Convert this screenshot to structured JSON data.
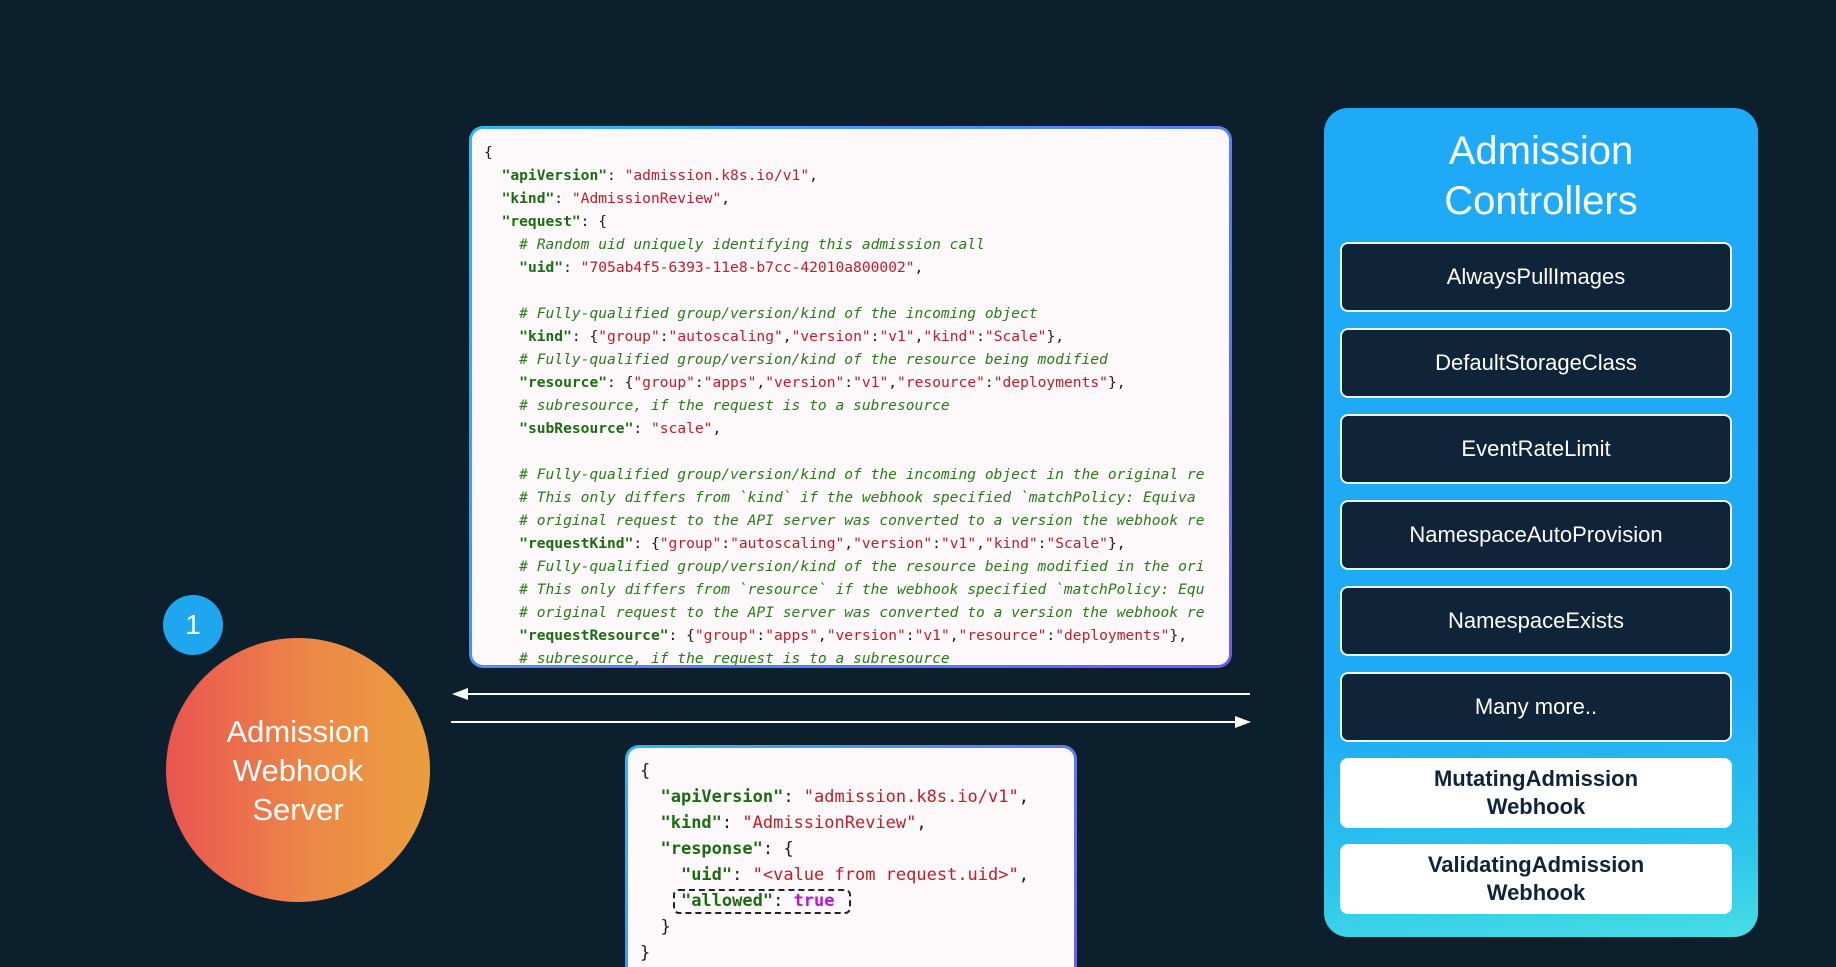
{
  "request_code": {
    "lines": [
      [
        [
          "p",
          "{"
        ]
      ],
      [
        [
          "p",
          "  "
        ],
        [
          "k",
          "\"apiVersion\""
        ],
        [
          "p",
          ": "
        ],
        [
          "s",
          "\"admission.k8s.io/v1\""
        ],
        [
          "p",
          ","
        ]
      ],
      [
        [
          "p",
          "  "
        ],
        [
          "k",
          "\"kind\""
        ],
        [
          "p",
          ": "
        ],
        [
          "s",
          "\"AdmissionReview\""
        ],
        [
          "p",
          ","
        ]
      ],
      [
        [
          "p",
          "  "
        ],
        [
          "k",
          "\"request\""
        ],
        [
          "p",
          ": {"
        ]
      ],
      [
        [
          "p",
          "    "
        ],
        [
          "c",
          "# Random uid uniquely identifying this admission call"
        ]
      ],
      [
        [
          "p",
          "    "
        ],
        [
          "k",
          "\"uid\""
        ],
        [
          "p",
          ": "
        ],
        [
          "s",
          "\"705ab4f5-6393-11e8-b7cc-42010a800002\""
        ],
        [
          "p",
          ","
        ]
      ],
      [
        [
          "p",
          ""
        ]
      ],
      [
        [
          "p",
          "    "
        ],
        [
          "c",
          "# Fully-qualified group/version/kind of the incoming object"
        ]
      ],
      [
        [
          "p",
          "    "
        ],
        [
          "k",
          "\"kind\""
        ],
        [
          "p",
          ": {"
        ],
        [
          "s",
          "\"group\""
        ],
        [
          "p",
          ":"
        ],
        [
          "s",
          "\"autoscaling\""
        ],
        [
          "p",
          ","
        ],
        [
          "s",
          "\"version\""
        ],
        [
          "p",
          ":"
        ],
        [
          "s",
          "\"v1\""
        ],
        [
          "p",
          ","
        ],
        [
          "s",
          "\"kind\""
        ],
        [
          "p",
          ":"
        ],
        [
          "s",
          "\"Scale\""
        ],
        [
          "p",
          "},"
        ]
      ],
      [
        [
          "p",
          "    "
        ],
        [
          "c",
          "# Fully-qualified group/version/kind of the resource being modified"
        ]
      ],
      [
        [
          "p",
          "    "
        ],
        [
          "k",
          "\"resource\""
        ],
        [
          "p",
          ": {"
        ],
        [
          "s",
          "\"group\""
        ],
        [
          "p",
          ":"
        ],
        [
          "s",
          "\"apps\""
        ],
        [
          "p",
          ","
        ],
        [
          "s",
          "\"version\""
        ],
        [
          "p",
          ":"
        ],
        [
          "s",
          "\"v1\""
        ],
        [
          "p",
          ","
        ],
        [
          "s",
          "\"resource\""
        ],
        [
          "p",
          ":"
        ],
        [
          "s",
          "\"deployments\""
        ],
        [
          "p",
          "},"
        ]
      ],
      [
        [
          "p",
          "    "
        ],
        [
          "c",
          "# subresource, if the request is to a subresource"
        ]
      ],
      [
        [
          "p",
          "    "
        ],
        [
          "k",
          "\"subResource\""
        ],
        [
          "p",
          ": "
        ],
        [
          "s",
          "\"scale\""
        ],
        [
          "p",
          ","
        ]
      ],
      [
        [
          "p",
          ""
        ]
      ],
      [
        [
          "p",
          "    "
        ],
        [
          "c",
          "# Fully-qualified group/version/kind of the incoming object in the original re"
        ]
      ],
      [
        [
          "p",
          "    "
        ],
        [
          "c",
          "# This only differs from `kind` if the webhook specified `matchPolicy: Equiva"
        ]
      ],
      [
        [
          "p",
          "    "
        ],
        [
          "c",
          "# original request to the API server was converted to a version the webhook re"
        ]
      ],
      [
        [
          "p",
          "    "
        ],
        [
          "k",
          "\"requestKind\""
        ],
        [
          "p",
          ": {"
        ],
        [
          "s",
          "\"group\""
        ],
        [
          "p",
          ":"
        ],
        [
          "s",
          "\"autoscaling\""
        ],
        [
          "p",
          ","
        ],
        [
          "s",
          "\"version\""
        ],
        [
          "p",
          ":"
        ],
        [
          "s",
          "\"v1\""
        ],
        [
          "p",
          ","
        ],
        [
          "s",
          "\"kind\""
        ],
        [
          "p",
          ":"
        ],
        [
          "s",
          "\"Scale\""
        ],
        [
          "p",
          "},"
        ]
      ],
      [
        [
          "p",
          "    "
        ],
        [
          "c",
          "# Fully-qualified group/version/kind of the resource being modified in the ori"
        ]
      ],
      [
        [
          "p",
          "    "
        ],
        [
          "c",
          "# This only differs from `resource` if the webhook specified `matchPolicy: Equ"
        ]
      ],
      [
        [
          "p",
          "    "
        ],
        [
          "c",
          "# original request to the API server was converted to a version the webhook re"
        ]
      ],
      [
        [
          "p",
          "    "
        ],
        [
          "k",
          "\"requestResource\""
        ],
        [
          "p",
          ": {"
        ],
        [
          "s",
          "\"group\""
        ],
        [
          "p",
          ":"
        ],
        [
          "s",
          "\"apps\""
        ],
        [
          "p",
          ","
        ],
        [
          "s",
          "\"version\""
        ],
        [
          "p",
          ":"
        ],
        [
          "s",
          "\"v1\""
        ],
        [
          "p",
          ","
        ],
        [
          "s",
          "\"resource\""
        ],
        [
          "p",
          ":"
        ],
        [
          "s",
          "\"deployments\""
        ],
        [
          "p",
          "},"
        ]
      ],
      [
        [
          "p",
          "    "
        ],
        [
          "c",
          "# subresource, if the request is to a subresource"
        ]
      ]
    ]
  },
  "response_code": {
    "line1": "{",
    "api_key": "\"apiVersion\"",
    "api_val": "\"admission.k8s.io/v1\"",
    "kind_key": "\"kind\"",
    "kind_val": "\"AdmissionReview\"",
    "resp_key": "\"response\"",
    "uid_key": "\"uid\"",
    "uid_val": "\"<value from request.uid>\"",
    "allowed_key": "\"allowed\"",
    "allowed_val": "true",
    "close_inner": "}",
    "close_outer": "}"
  },
  "server": {
    "label": "Admission Webhook Server",
    "step": "1"
  },
  "panel": {
    "title": "Admission Controllers",
    "controllers": [
      "AlwaysPullImages",
      "DefaultStorageClass",
      "EventRateLimit",
      "NamespaceAutoProvision",
      "NamespaceExists",
      "Many more..",
      "MutatingAdmission Webhook",
      "ValidatingAdmission Webhook"
    ]
  },
  "colors": {
    "background": "#0c1f2d",
    "panel": "#1eaaf6",
    "controller_dark": "#0f2439",
    "server_start": "#ea5450",
    "server_end": "#eb9e3e",
    "badge": "#1ea7ef"
  }
}
